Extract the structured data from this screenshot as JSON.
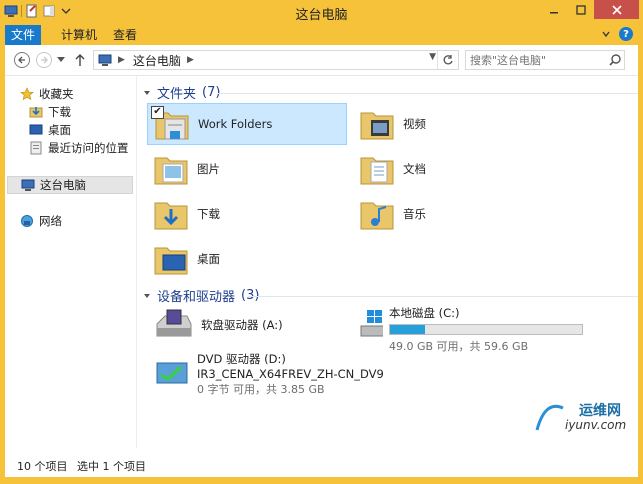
{
  "window": {
    "title": "这台电脑"
  },
  "ribbon": {
    "tabs": [
      "文件",
      "计算机",
      "查看"
    ]
  },
  "nav": {
    "address_location": "这台电脑",
    "search_placeholder": "搜索\"这台电脑\""
  },
  "sidebar": {
    "favorites": "收藏夹",
    "fav_items": [
      "下载",
      "桌面",
      "最近访问的位置"
    ],
    "this_pc": "这台电脑",
    "network": "网络"
  },
  "folders": {
    "header": "文件夹",
    "count": "(7)",
    "items": [
      "Work Folders",
      "视频",
      "图片",
      "文档",
      "下载",
      "音乐",
      "桌面"
    ]
  },
  "devices": {
    "header": "设备和驱动器",
    "count": "(3)",
    "floppy": "软盘驱动器 (A:)",
    "local_disk": {
      "name": "本地磁盘 (C:)",
      "space": "49.0 GB 可用，共 59.6 GB",
      "used_fraction": 0.18
    },
    "dvd": {
      "name": "DVD 驱动器 (D:)",
      "label": "IR3_CENA_X64FREV_ZH-CN_DV9",
      "space": "0 字节 可用，共 3.85 GB"
    }
  },
  "status": {
    "item_count": "10 个项目",
    "selected": "选中 1 个项目"
  },
  "watermark": {
    "text": "运维网",
    "sub": "iyunv.com"
  },
  "colors": {
    "frame": "#f5c23a",
    "accent": "#1979ca",
    "bar": "#26a0da",
    "header_text": "#1e3e8e"
  }
}
